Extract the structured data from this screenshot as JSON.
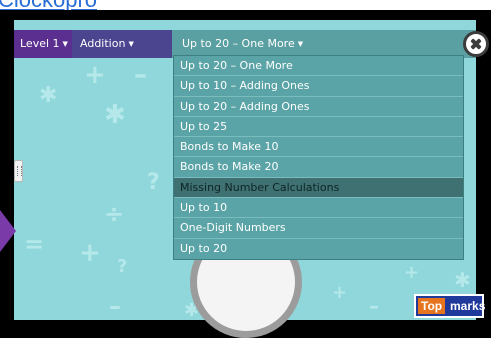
{
  "page_link": {
    "text": "Clockopro"
  },
  "toolbar": {
    "level_label": "Level 1",
    "operation_label": "Addition",
    "selected_mode": "Up to 20 – One More"
  },
  "dropdown": {
    "items": [
      "Up to 20 – One More",
      "Up to 10 – Adding Ones",
      "Up to 20 – Adding Ones",
      "Up to 25",
      "Bonds to Make 10",
      "Bonds to Make 20",
      "Missing Number Calculations",
      "Up to 10",
      "One-Digit Numbers",
      "Up to 20"
    ],
    "highlighted_item": "Missing Number Calculations"
  },
  "branding": {
    "logo_part1": "Top",
    "logo_part2": "marks"
  },
  "icons": {
    "close": "close-icon",
    "caret": "chevron-down-icon",
    "handle": "drag-handle-icon"
  },
  "colors": {
    "background": "#8fd7da",
    "toolbar": "#3f3b7e",
    "level_bg": "#5b2f8f",
    "dropdown_bg": "#5aa3a6",
    "highlight": "#3f7173",
    "logo_orange": "#e6731e",
    "logo_blue": "#1f3a9a"
  }
}
